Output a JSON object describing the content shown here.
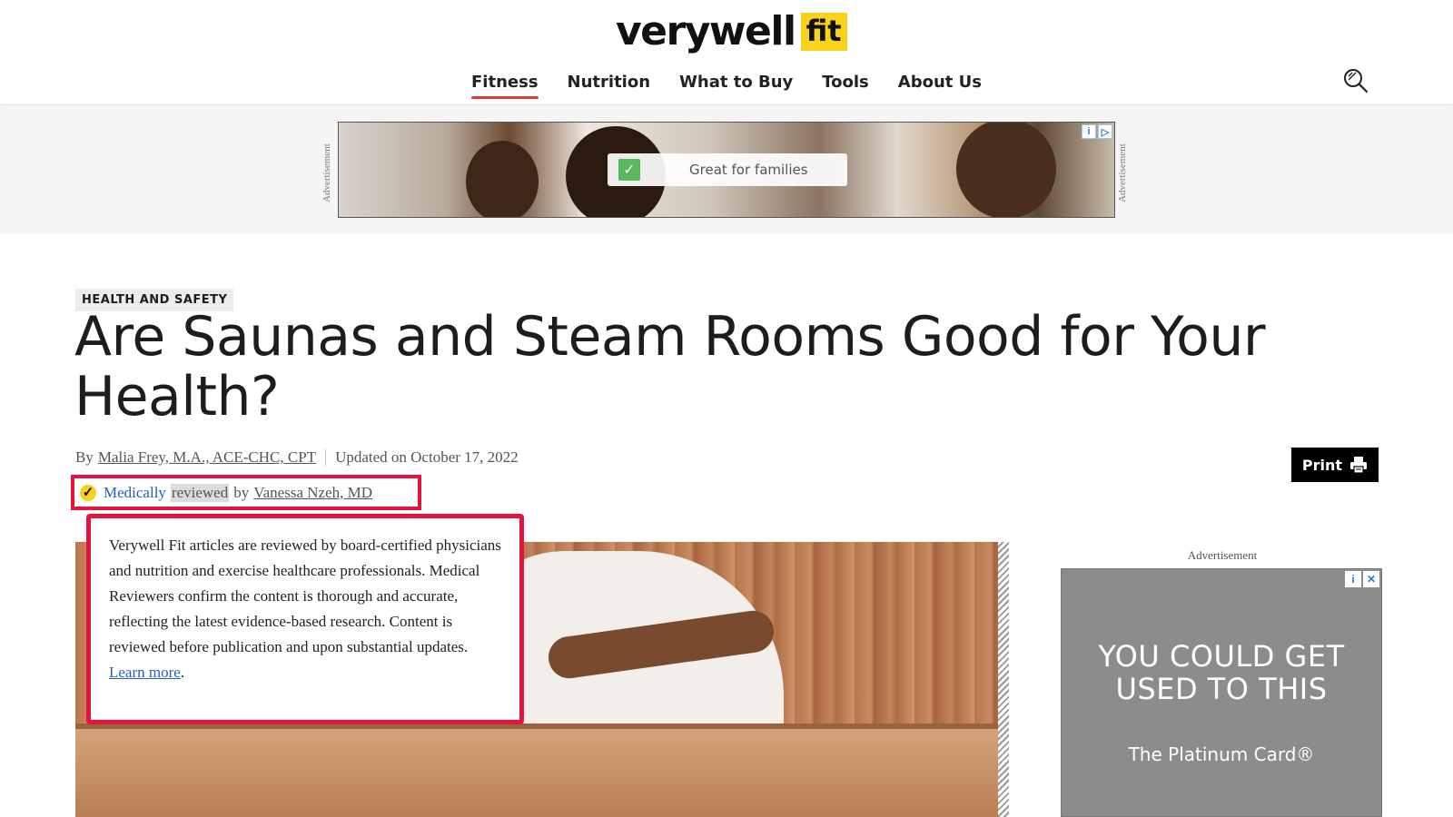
{
  "header": {
    "logo_word": "verywell",
    "logo_badge": "fit",
    "nav": [
      {
        "label": "Fitness",
        "active": true
      },
      {
        "label": "Nutrition",
        "active": false
      },
      {
        "label": "What to Buy",
        "active": false
      },
      {
        "label": "Tools",
        "active": false
      },
      {
        "label": "About Us",
        "active": false
      }
    ],
    "search_icon": "search-icon"
  },
  "top_ad": {
    "side_label": "Advertisement",
    "pill_text": "Great for families"
  },
  "article": {
    "tag": "HEALTH AND SAFETY",
    "title": "Are Saunas and Steam Rooms Good for Your Health?",
    "by_prefix": "By",
    "author": "Malia Frey, M.A., ACE-CHC, CPT",
    "updated": "Updated on October 17, 2022",
    "print_label": "Print",
    "review": {
      "medically": "Medically",
      "reviewed": "reviewed",
      "by": "by",
      "reviewer": "Vanessa Nzeh, MD"
    },
    "tooltip": {
      "text": "Verywell Fit articles are reviewed by board-certified physicians and nutrition and exercise healthcare professionals. Medical Reviewers confirm the content is thorough and accurate, reflecting the latest evidence-based research. Content is reviewed before publication and upon substantial updates.",
      "link": "Learn more",
      "after_link": "."
    }
  },
  "side_ad": {
    "label": "Advertisement",
    "headline_line1": "YOU COULD GET",
    "headline_line2": "USED TO THIS",
    "sub": "The Platinum Card®"
  },
  "colors": {
    "accent_red": "#e13a34",
    "highlight_box": "#e3143f",
    "logo_yellow": "#f9d21b",
    "link_blue": "#2960b4"
  }
}
